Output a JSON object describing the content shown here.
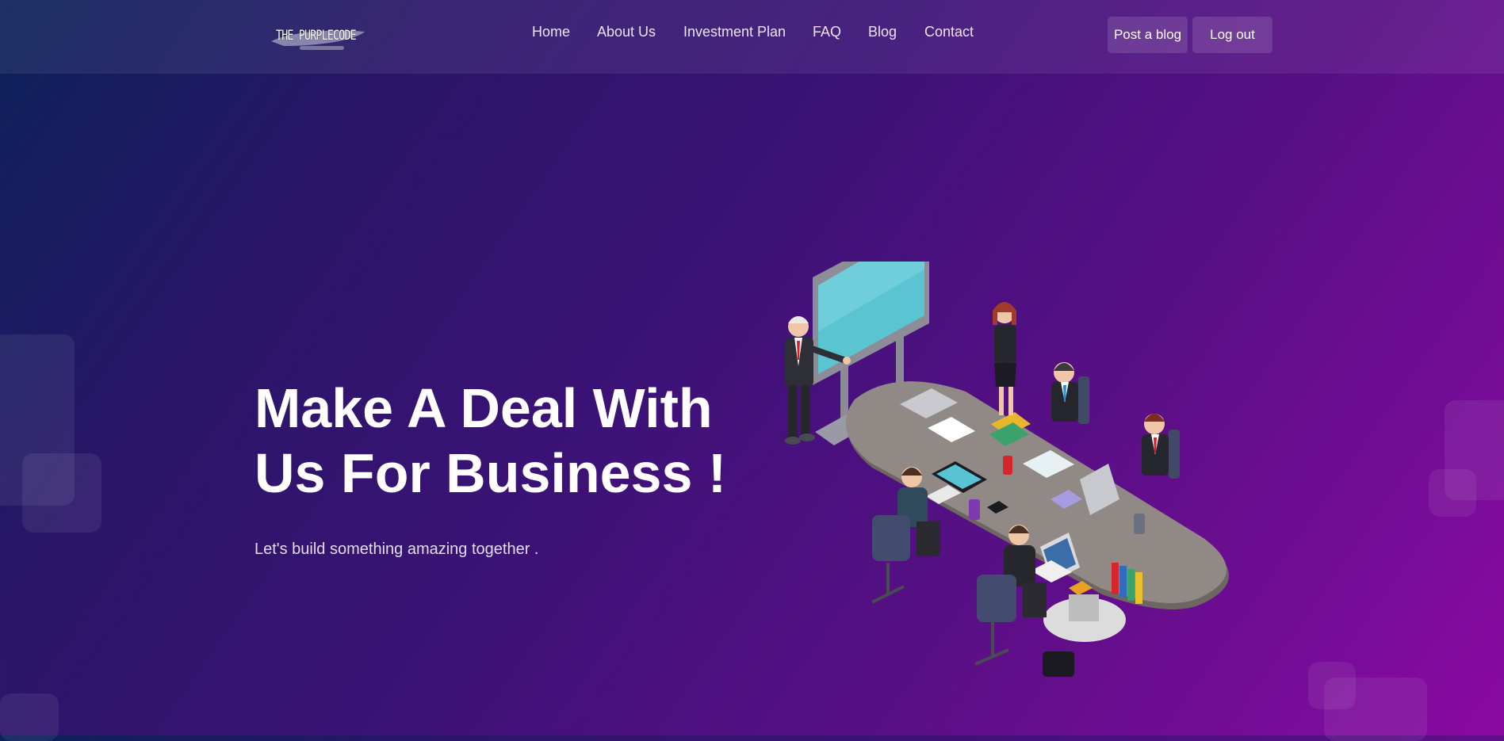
{
  "brand": {
    "logo_text": "THE PURPLECODE"
  },
  "nav": {
    "items": [
      {
        "label": "Home"
      },
      {
        "label": "About Us"
      },
      {
        "label": "Investment Plan"
      },
      {
        "label": "FAQ"
      },
      {
        "label": "Blog"
      },
      {
        "label": "Contact"
      }
    ]
  },
  "actions": {
    "post_blog_label": "Post a blog",
    "logout_label": "Log out"
  },
  "hero": {
    "title_line1": "Make A Deal With",
    "title_line2": "Us For Business !",
    "subtitle": "Let's build something amazing together ."
  },
  "colors": {
    "gradient_start": "#0b2259",
    "gradient_end": "#8a0aa3",
    "text": "#ffffff"
  },
  "illustration": {
    "name": "business-meeting-illustration"
  }
}
